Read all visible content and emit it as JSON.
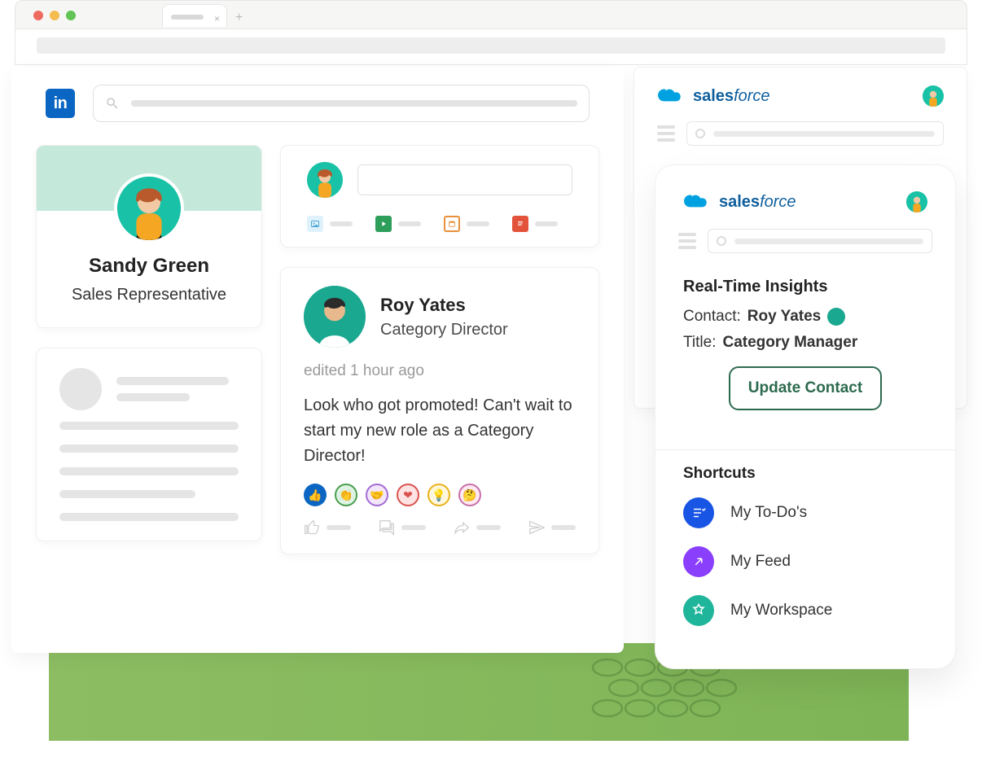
{
  "browser": {
    "tab_close": "×",
    "new_tab": "+"
  },
  "linkedin": {
    "logo": "in",
    "profile": {
      "name": "Sandy Green",
      "title": "Sales Representative"
    },
    "compose_placeholder": "",
    "icons": [
      "photo-icon",
      "video-icon",
      "event-icon",
      "article-icon"
    ]
  },
  "post": {
    "author": "Roy Yates",
    "author_title": "Category Director",
    "edited": "edited 1 hour ago",
    "body": "Look who got promoted! Can't wait to start my new role as a Category Director!",
    "reactions": [
      "like",
      "clap",
      "support",
      "love",
      "insight",
      "curious"
    ],
    "actions": [
      "like",
      "comment",
      "share",
      "send"
    ]
  },
  "salesforce": {
    "brand": "salesforce",
    "insights_title": "Real-Time Insights",
    "contact_label": "Contact:",
    "contact_name": "Roy Yates",
    "title_label": "Title:",
    "title_value": "Category Manager",
    "update_button": "Update Contact",
    "shortcuts_title": "Shortcuts",
    "shortcuts": [
      {
        "label": "My To-Do's",
        "icon": "todo-icon",
        "color": "sc-blue"
      },
      {
        "label": "My Feed",
        "icon": "feed-icon",
        "color": "sc-purple"
      },
      {
        "label": "My Workspace",
        "icon": "workspace-icon",
        "color": "sc-teal"
      }
    ]
  }
}
